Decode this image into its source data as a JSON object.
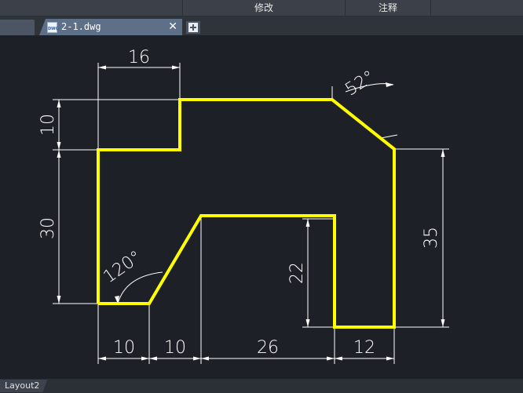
{
  "menubar": {
    "items": [
      {
        "label": "修改"
      },
      {
        "label": "注释"
      }
    ]
  },
  "tabs": {
    "active_file": "2-1.dwg",
    "close_glyph": "✕",
    "icons": [
      "dwg-file-icon",
      "close-icon",
      "new-tab-icon"
    ]
  },
  "drawing": {
    "outline_color": "#ffff00",
    "dimension_color": "#ffffff",
    "dimensions": {
      "top_width": "16",
      "left_step": "10",
      "left_height": "30",
      "right_height": "35",
      "inner_height": "22",
      "bottom_1": "10",
      "bottom_2": "10",
      "bottom_3": "26",
      "bottom_4": "12",
      "angle_top": "52°",
      "angle_bottom": "120°"
    }
  },
  "status": {
    "layout_tab": "Layout2"
  }
}
